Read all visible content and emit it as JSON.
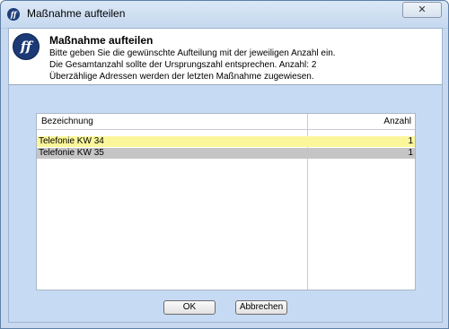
{
  "window": {
    "title": "Maßnahme aufteilen",
    "close_label": "✕"
  },
  "header": {
    "logo_text": "ff",
    "heading": "Maßnahme aufteilen",
    "line1": "Bitte geben Sie die gewünschte Aufteilung mit der jeweiligen Anzahl ein.",
    "line2": "Die Gesamtanzahl sollte der Ursprungszahl entsprechen. Anzahl: 2",
    "line3": "Überzählige Adressen werden der letzten Maßnahme zugewiesen."
  },
  "table": {
    "columns": [
      "Bezeichnung",
      "Anzahl"
    ],
    "rows": [
      {
        "name": "Telefonie KW 34",
        "count": "1"
      },
      {
        "name": "Telefonie KW 35",
        "count": "1"
      }
    ]
  },
  "buttons": {
    "ok": "OK",
    "cancel": "Abbrechen"
  },
  "colors": {
    "row_highlight": "#fbf69a",
    "row_selected": "#c5c5c5",
    "logo": "#1c3a76"
  }
}
